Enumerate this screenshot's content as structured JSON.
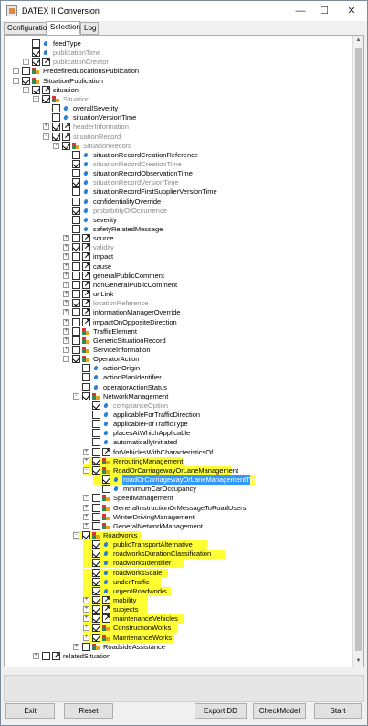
{
  "window": {
    "title": "DATEX II Conversion",
    "minimize": "—",
    "maximize": "☐",
    "close": "✕"
  },
  "tabs": [
    {
      "label": "Configuration",
      "active": false
    },
    {
      "label": "Selection",
      "active": true
    },
    {
      "label": "Log",
      "active": false
    }
  ],
  "tree": [
    {
      "label": "feedType",
      "depth": 1,
      "cb": false,
      "icon": "attr",
      "exp": "",
      "grey": false
    },
    {
      "label": "publicationTime",
      "depth": 1,
      "cb": true,
      "icon": "attr",
      "exp": "",
      "grey": true
    },
    {
      "label": "publicationCreator",
      "depth": 1,
      "cb": true,
      "icon": "ref",
      "exp": "+",
      "grey": true
    },
    {
      "label": "PredefinedLocationsPublication",
      "depth": 0,
      "cb": false,
      "icon": "cls",
      "exp": "+",
      "grey": false
    },
    {
      "label": "SituationPublication",
      "depth": 0,
      "cb": true,
      "icon": "cls",
      "exp": "-",
      "grey": false
    },
    {
      "label": "situation",
      "depth": 1,
      "cb": true,
      "icon": "ref",
      "exp": "-",
      "grey": false
    },
    {
      "label": "Situation",
      "depth": 2,
      "cb": true,
      "icon": "cls",
      "exp": "-",
      "grey": true
    },
    {
      "label": "overallSeverity",
      "depth": 3,
      "cb": false,
      "icon": "attr",
      "exp": "",
      "grey": false
    },
    {
      "label": "situationVersionTime",
      "depth": 3,
      "cb": false,
      "icon": "attr",
      "exp": "",
      "grey": false
    },
    {
      "label": "headerInformation",
      "depth": 3,
      "cb": true,
      "icon": "ref",
      "exp": "+",
      "grey": true
    },
    {
      "label": "situationRecord",
      "depth": 3,
      "cb": true,
      "icon": "ref",
      "exp": "-",
      "grey": true
    },
    {
      "label": "SituationRecord",
      "depth": 4,
      "cb": true,
      "icon": "cls",
      "exp": "-",
      "grey": true
    },
    {
      "label": "situationRecordCreationReference",
      "depth": 5,
      "cb": false,
      "icon": "attr",
      "exp": "",
      "grey": false
    },
    {
      "label": "situationRecordCreationTime",
      "depth": 5,
      "cb": true,
      "icon": "attr",
      "exp": "",
      "grey": true
    },
    {
      "label": "situationRecordObservationTime",
      "depth": 5,
      "cb": false,
      "icon": "attr",
      "exp": "",
      "grey": false
    },
    {
      "label": "situationRecordVersionTime",
      "depth": 5,
      "cb": true,
      "icon": "attr",
      "exp": "",
      "grey": true
    },
    {
      "label": "situationRecordFirstSupplierVersionTime",
      "depth": 5,
      "cb": false,
      "icon": "attr",
      "exp": "",
      "grey": false
    },
    {
      "label": "confidentialityOverride",
      "depth": 5,
      "cb": false,
      "icon": "attr",
      "exp": "",
      "grey": false
    },
    {
      "label": "probabilityOfOccurrence",
      "depth": 5,
      "cb": true,
      "icon": "attr",
      "exp": "",
      "grey": true
    },
    {
      "label": "severity",
      "depth": 5,
      "cb": false,
      "icon": "attr",
      "exp": "",
      "grey": false
    },
    {
      "label": "safetyRelatedMessage",
      "depth": 5,
      "cb": false,
      "icon": "attr",
      "exp": "",
      "grey": false
    },
    {
      "label": "source",
      "depth": 5,
      "cb": false,
      "icon": "ref",
      "exp": "+",
      "grey": false
    },
    {
      "label": "validity",
      "depth": 5,
      "cb": true,
      "icon": "ref",
      "exp": "+",
      "grey": true
    },
    {
      "label": "impact",
      "depth": 5,
      "cb": false,
      "icon": "ref",
      "exp": "+",
      "grey": false
    },
    {
      "label": "cause",
      "depth": 5,
      "cb": false,
      "icon": "ref",
      "exp": "+",
      "grey": false
    },
    {
      "label": "generalPublicComment",
      "depth": 5,
      "cb": false,
      "icon": "ref",
      "exp": "+",
      "grey": false
    },
    {
      "label": "nonGeneralPublicComment",
      "depth": 5,
      "cb": false,
      "icon": "ref",
      "exp": "+",
      "grey": false
    },
    {
      "label": "urlLink",
      "depth": 5,
      "cb": false,
      "icon": "ref",
      "exp": "+",
      "grey": false
    },
    {
      "label": "locationReference",
      "depth": 5,
      "cb": true,
      "icon": "ref",
      "exp": "+",
      "grey": true
    },
    {
      "label": "informationManagerOverride",
      "depth": 5,
      "cb": false,
      "icon": "ref",
      "exp": "+",
      "grey": false
    },
    {
      "label": "impactOnOppositeDirection",
      "depth": 5,
      "cb": false,
      "icon": "ref",
      "exp": "+",
      "grey": false
    },
    {
      "label": "TrafficElement",
      "depth": 5,
      "cb": false,
      "icon": "cls",
      "exp": "+",
      "grey": false
    },
    {
      "label": "GenericSituationRecord",
      "depth": 5,
      "cb": false,
      "icon": "cls",
      "exp": "+",
      "grey": false
    },
    {
      "label": "ServiceInformation",
      "depth": 5,
      "cb": false,
      "icon": "cls",
      "exp": "+",
      "grey": false
    },
    {
      "label": "OperatorAction",
      "depth": 5,
      "cb": true,
      "icon": "cls",
      "exp": "-",
      "grey": false
    },
    {
      "label": "actionOrigin",
      "depth": 6,
      "cb": false,
      "icon": "attr",
      "exp": "",
      "grey": false
    },
    {
      "label": "actionPlanIdentifier",
      "depth": 6,
      "cb": false,
      "icon": "attr",
      "exp": "",
      "grey": false
    },
    {
      "label": "operatorActionStatus",
      "depth": 6,
      "cb": false,
      "icon": "attr",
      "exp": "",
      "grey": false
    },
    {
      "label": "NetworkManagement",
      "depth": 6,
      "cb": true,
      "icon": "cls",
      "exp": "-",
      "grey": false
    },
    {
      "label": "complianceOption",
      "depth": 7,
      "cb": true,
      "icon": "attr",
      "exp": "",
      "grey": true
    },
    {
      "label": "applicableForTrafficDirection",
      "depth": 7,
      "cb": false,
      "icon": "attr",
      "exp": "",
      "grey": false
    },
    {
      "label": "applicableForTrafficType",
      "depth": 7,
      "cb": false,
      "icon": "attr",
      "exp": "",
      "grey": false
    },
    {
      "label": "placesAtWhichApplicable",
      "depth": 7,
      "cb": false,
      "icon": "attr",
      "exp": "",
      "grey": false
    },
    {
      "label": "automaticallyInitiated",
      "depth": 7,
      "cb": false,
      "icon": "attr",
      "exp": "",
      "grey": false
    },
    {
      "label": "forVehiclesWithCharacteristicsOf",
      "depth": 7,
      "cb": false,
      "icon": "ref",
      "exp": "+",
      "grey": false
    },
    {
      "label": "ReroutingManagement",
      "depth": 7,
      "cb": true,
      "icon": "cls",
      "exp": "+",
      "grey": false,
      "hl": true
    },
    {
      "label": "RoadOrCarriagewayOrLaneManagement",
      "depth": 7,
      "cb": true,
      "icon": "cls",
      "exp": "-",
      "grey": false,
      "hl": true
    },
    {
      "label": "roadOrCarriagewayOrLaneManagementType",
      "depth": 8,
      "cb": true,
      "icon": "attr",
      "exp": "",
      "grey": false,
      "hl": true,
      "sel": true
    },
    {
      "label": "minimumCarOccupancy",
      "depth": 8,
      "cb": false,
      "icon": "attr",
      "exp": "",
      "grey": false
    },
    {
      "label": "SpeedManagement",
      "depth": 7,
      "cb": false,
      "icon": "cls",
      "exp": "+",
      "grey": false
    },
    {
      "label": "GeneralInstructionOrMessageToRoadUsers",
      "depth": 7,
      "cb": false,
      "icon": "cls",
      "exp": "+",
      "grey": false
    },
    {
      "label": "WinterDrivingManagement",
      "depth": 7,
      "cb": false,
      "icon": "cls",
      "exp": "+",
      "grey": false
    },
    {
      "label": "GeneralNetworkManagement",
      "depth": 7,
      "cb": false,
      "icon": "cls",
      "exp": "+",
      "grey": false
    },
    {
      "label": "Roadworks",
      "depth": 6,
      "cb": true,
      "icon": "cls",
      "exp": "-",
      "grey": false,
      "hl": true
    },
    {
      "label": "publicTransportAlternative",
      "depth": 7,
      "cb": true,
      "icon": "attr",
      "exp": "",
      "grey": false,
      "hl": true
    },
    {
      "label": "roadworksDurationClassification",
      "depth": 7,
      "cb": true,
      "icon": "attr",
      "exp": "",
      "grey": false,
      "hl": true
    },
    {
      "label": "roadworksIdentifier",
      "depth": 7,
      "cb": true,
      "icon": "attr",
      "exp": "",
      "grey": false,
      "hl": true
    },
    {
      "label": "roadworksScale",
      "depth": 7,
      "cb": true,
      "icon": "attr",
      "exp": "",
      "grey": false,
      "hl": true
    },
    {
      "label": "underTraffic",
      "depth": 7,
      "cb": true,
      "icon": "attr",
      "exp": "",
      "grey": false,
      "hl": true
    },
    {
      "label": "urgentRoadworks",
      "depth": 7,
      "cb": true,
      "icon": "attr",
      "exp": "",
      "grey": false,
      "hl": true
    },
    {
      "label": "mobility",
      "depth": 7,
      "cb": true,
      "icon": "ref",
      "exp": "+",
      "grey": false,
      "hl": true
    },
    {
      "label": "subjects",
      "depth": 7,
      "cb": true,
      "icon": "ref",
      "exp": "+",
      "grey": false,
      "hl": true
    },
    {
      "label": "maintenanceVehicles",
      "depth": 7,
      "cb": true,
      "icon": "ref",
      "exp": "+",
      "grey": false,
      "hl": true
    },
    {
      "label": "ConstructionWorks",
      "depth": 7,
      "cb": true,
      "icon": "cls",
      "exp": "+",
      "grey": false,
      "hl": true
    },
    {
      "label": "MaintenanceWorks",
      "depth": 7,
      "cb": true,
      "icon": "cls",
      "exp": "+",
      "grey": false,
      "hl": true
    },
    {
      "label": "RoadsideAssistance",
      "depth": 6,
      "cb": false,
      "icon": "cls",
      "exp": "+",
      "grey": false
    },
    {
      "label": "relatedSituation",
      "depth": 2,
      "cb": false,
      "icon": "ref",
      "exp": "+",
      "grey": false
    }
  ],
  "buttons": {
    "exit": "Exit",
    "reset": "Reset",
    "export": "Export DD",
    "check": "CheckModel",
    "start": "Start"
  },
  "colors": {
    "highlight": "#ffff33",
    "selection": "#3399ff"
  }
}
